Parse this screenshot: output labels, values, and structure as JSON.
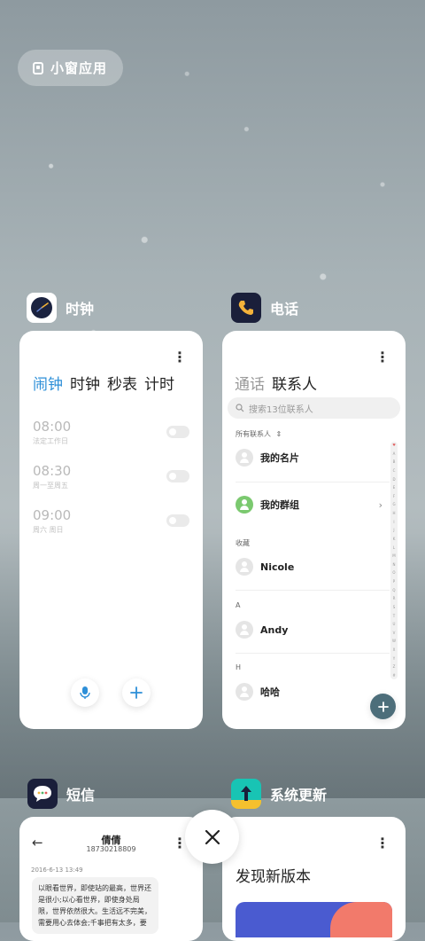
{
  "small_window": {
    "label": "小窗应用",
    "icon": "small-window-icon"
  },
  "clock": {
    "app_title": "时钟",
    "tabs": [
      "闹钟",
      "时钟",
      "秒表",
      "计时"
    ],
    "alarms": [
      {
        "time": "08:00",
        "repeat": "法定工作日"
      },
      {
        "time": "08:30",
        "repeat": "周一至周五"
      },
      {
        "time": "09:00",
        "repeat": "周六 周日"
      }
    ],
    "more": "⋮"
  },
  "phone": {
    "app_title": "电话",
    "tabs": [
      "通话",
      "联系人"
    ],
    "search_placeholder": "搜索13位联系人",
    "all_contacts": "所有联系人",
    "my_card": "我的名片",
    "my_groups": "我的群组",
    "favorites": "收藏",
    "contacts": [
      {
        "section": "",
        "name": "Nicole"
      },
      {
        "section": "A",
        "name": "Andy"
      },
      {
        "section": "H",
        "name": "哈哈"
      }
    ],
    "alphabet": [
      "♥",
      "A",
      "B",
      "C",
      "D",
      "E",
      "F",
      "G",
      "H",
      "I",
      "J",
      "K",
      "L",
      "M",
      "N",
      "O",
      "P",
      "Q",
      "R",
      "S",
      "T",
      "U",
      "V",
      "W",
      "X",
      "Y",
      "Z",
      "#"
    ],
    "more": "⋮"
  },
  "sms": {
    "app_title": "短信",
    "contact_name": "倩倩",
    "contact_number": "18730218809",
    "date": "2016-6-13 13:49",
    "message": "以眼看世界，即使站的最高，世界还是很小;以心看世界，即使身处局限，世界依然很大。生活远不完美，需要用心去体会;千事把有太多，要"
  },
  "update": {
    "app_title": "系统更新",
    "heading": "发现新版本",
    "more": "⋮"
  },
  "colors": {
    "accent": "#2d8fd8",
    "clock_icon_bg": "#1b2340",
    "phone_icon_bg": "#1a1f3a",
    "update_icon_bg": "#18c4b4"
  }
}
